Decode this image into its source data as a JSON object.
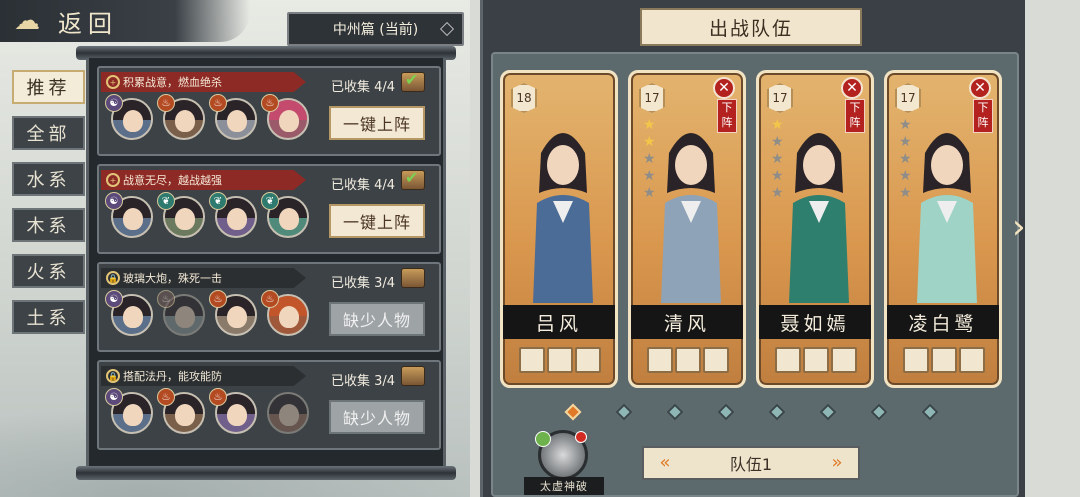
{
  "header": {
    "back_label": "返回",
    "chapter_label": "中州篇 (当前)"
  },
  "tabs": [
    {
      "label": "推荐",
      "active": true
    },
    {
      "label": "全部",
      "active": false
    },
    {
      "label": "水系",
      "active": false
    },
    {
      "label": "木系",
      "active": false
    },
    {
      "label": "火系",
      "active": false
    },
    {
      "label": "土系",
      "active": false
    }
  ],
  "combos": [
    {
      "title": "积累战意，燃血绝杀",
      "collected": "已收集 4/4",
      "action": "一键上阵",
      "style": "red",
      "complete": true
    },
    {
      "title": "战意无尽，越战越强",
      "collected": "已收集 4/4",
      "action": "一键上阵",
      "style": "red",
      "complete": true
    },
    {
      "title": "玻璃大炮，殊死一击",
      "collected": "已收集 3/4",
      "action": "缺少人物",
      "style": "dark",
      "complete": false
    },
    {
      "title": "搭配法丹，能攻能防",
      "collected": "已收集 3/4",
      "action": "缺少人物",
      "style": "dark",
      "complete": false
    }
  ],
  "team": {
    "title": "出战队伍",
    "remove_label": "下阵",
    "team_label": "队伍1",
    "ultimate_label": "太虚神破",
    "members": [
      {
        "name": "吕风",
        "level": "18",
        "stars": 0,
        "removable": false,
        "outfit": "#4b6c97"
      },
      {
        "name": "清风",
        "level": "17",
        "stars": 2,
        "removable": true,
        "outfit": "#8ea3b8"
      },
      {
        "name": "聂如嫣",
        "level": "17",
        "stars": 1,
        "removable": true,
        "outfit": "#2f7f6e"
      },
      {
        "name": "凌白鹭",
        "level": "17",
        "stars": 0,
        "removable": true,
        "outfit": "#9fd3c6"
      }
    ]
  },
  "colors": {
    "accent_orange": "#e07a28",
    "banner_red": "#8e2a26",
    "panel_dark": "#24292d",
    "card_gold": "#d9974e"
  }
}
